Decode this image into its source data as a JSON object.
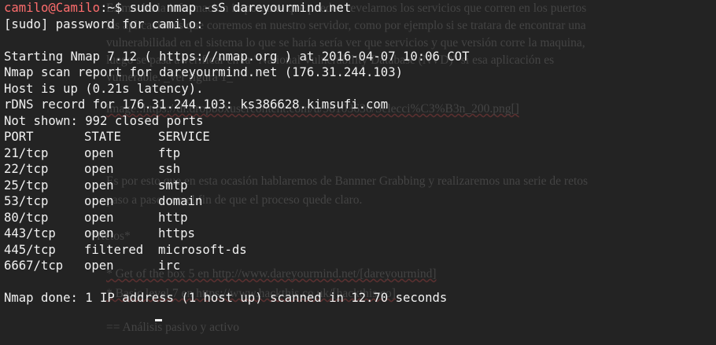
{
  "terminal": {
    "prompt_user": "camilo@Camilo",
    "prompt_suffix": ":~$",
    "command": " sudo nmap -sS dareyourmind.net",
    "lines": [
      "[sudo] password for camilo:",
      "",
      "Starting Nmap 7.12 ( https://nmap.org ) at 2016-04-07 10:06 COT",
      "Nmap scan report for dareyourmind.net (176.31.244.103)",
      "Host is up (0.21s latency).",
      "rDNS record for 176.31.244.103: ks386628.kimsufi.com",
      "Not shown: 992 closed ports"
    ],
    "port_table": {
      "headers": [
        "PORT",
        "STATE",
        "SERVICE"
      ],
      "rows": [
        [
          "21/tcp",
          "open",
          "ftp"
        ],
        [
          "22/tcp",
          "open",
          "ssh"
        ],
        [
          "25/tcp",
          "open",
          "smtp"
        ],
        [
          "53/tcp",
          "open",
          "domain"
        ],
        [
          "80/tcp",
          "open",
          "http"
        ],
        [
          "443/tcp",
          "open",
          "https"
        ],
        [
          "445/tcp",
          "filtered",
          "microsoft-ds"
        ],
        [
          "6667/tcp",
          "open",
          "irc"
        ]
      ]
    },
    "done_line": "Nmap done: 1 IP address (1 host up) scanned in 12.70 seconds"
  },
  "background_document": {
    "lines": [
      "Es mucha la información importante que pueden revelarnos los servicios que corren en los puertos",
      "las aplicaciones que corremos en nuestro servidor, como por ejemplo si se tratara de encontrar una",
      "vulnerabilidad en el sistema lo que se haría sería ver que servicios y que versión corre la maquina,",
      "luego se pasa a verificar en la \"National Vulnerability Database (NVD)\" si esa aplicación es",
      "vulnerable. _ver figura 1_",
      "image::https://dl.dropboxusercontent.com/u/98103636/Selecci%C3%B3n_200.png[]",
      "Es por esto que en esta ocasión hablaremos de Bannner Grabbing y realizaremos una serie de retos",
      "paso a paso con el fin de que el proceso quede claro.",
      "*Retos*",
      "* Get of the box 5 en http://www.dareyourmind.net/[dareyourmind]",
      "* Basic level 7 en  https://www.hackthis.co.uk/[hackthis.co]",
      "== Análisis pasivo y activo"
    ]
  },
  "colors": {
    "background": "#232323",
    "text": "#f2f2f2",
    "prompt_user": "#ff6d6d",
    "ghost_text": "#444444"
  }
}
